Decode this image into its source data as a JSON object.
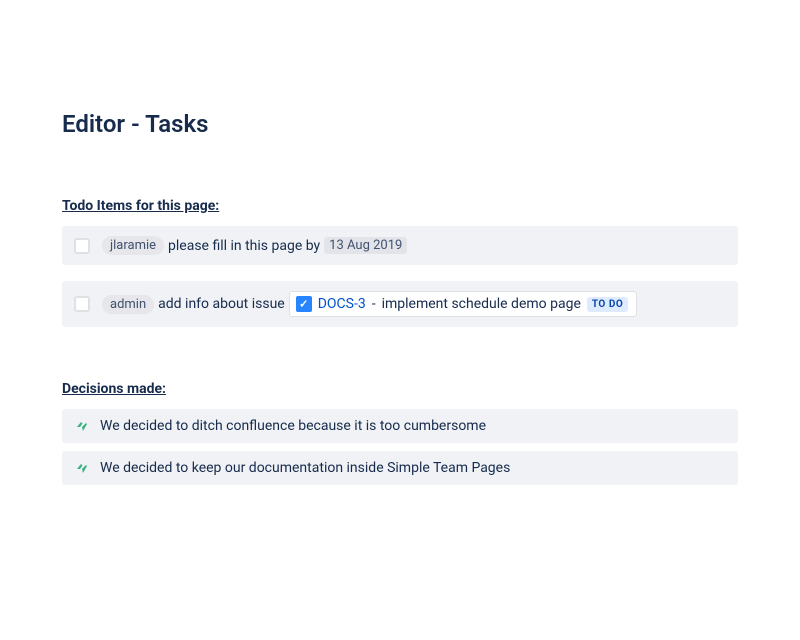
{
  "page": {
    "title": "Editor - Tasks"
  },
  "sections": {
    "todo_heading": "Todo Items for this page:",
    "decisions_heading": "Decisions made:"
  },
  "tasks": [
    {
      "mention": "jlaramie",
      "text_before_date": " please fill in this page by ",
      "date": "13 Aug 2019"
    },
    {
      "mention": "admin",
      "text_before_issue": " add info about issue ",
      "issue": {
        "key": "DOCS-3",
        "summary": "implement schedule demo page",
        "status": "TO DO"
      }
    }
  ],
  "decisions": [
    {
      "text": "We decided to ditch confluence because it is too cumbersome"
    },
    {
      "text": "We decided to keep our documentation inside Simple Team Pages"
    }
  ]
}
